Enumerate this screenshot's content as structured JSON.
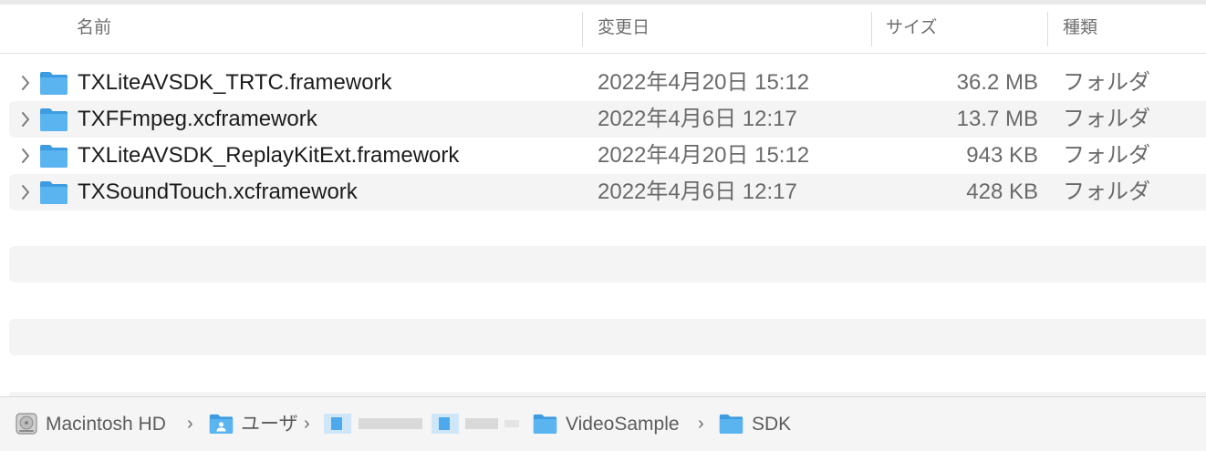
{
  "columns": {
    "name": "名前",
    "date": "変更日",
    "size": "サイズ",
    "kind": "種類"
  },
  "files": [
    {
      "name": "TXLiteAVSDK_TRTC.framework",
      "date": "2022年4月20日 15:12",
      "size": "36.2 MB",
      "kind": "フォルダ"
    },
    {
      "name": "TXFFmpeg.xcframework",
      "date": "2022年4月6日 12:17",
      "size": "13.7 MB",
      "kind": "フォルダ"
    },
    {
      "name": "TXLiteAVSDK_ReplayKitExt.framework",
      "date": "2022年4月20日 15:12",
      "size": "943 KB",
      "kind": "フォルダ"
    },
    {
      "name": "TXSoundTouch.xcframework",
      "date": "2022年4月6日 12:17",
      "size": "428 KB",
      "kind": "フォルダ"
    }
  ],
  "path_bar": {
    "items": [
      "Macintosh HD",
      "ユーザ",
      "VideoSample",
      "SDK"
    ],
    "separator": "›"
  },
  "icons": {
    "row_disclosure": "chevron-right-icon",
    "row_item": "folder-icon",
    "path_disk": "hard-drive-icon",
    "path_home": "home-folder-icon",
    "path_folder": "folder-icon"
  },
  "colors": {
    "folder_blue": "#5ab4f0",
    "folder_blue_dark": "#3d9be0",
    "stripe": "#f4f4f4",
    "header_text": "#6f6f6f",
    "secondary_text": "#6a6a6a"
  }
}
